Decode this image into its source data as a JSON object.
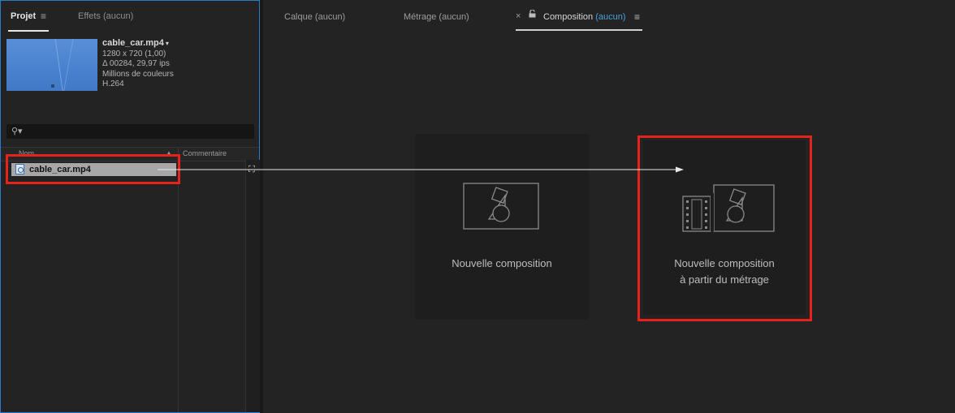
{
  "project_panel": {
    "tabs": [
      {
        "label": "Projet",
        "menu_glyph": "≡"
      },
      {
        "label": "Effets (aucun)"
      }
    ],
    "file_info": {
      "name": "cable_car.mp4",
      "caret": "▾",
      "lines": [
        "1280 x 720 (1,00)",
        "Δ 00284, 29,97 ips",
        "Millions de couleurs",
        "H.264"
      ]
    },
    "search": {
      "icon_glyph": "⚲▾",
      "value": "",
      "placeholder": ""
    },
    "columns": {
      "name": "Nom",
      "sort_glyph": "▲",
      "comment": "Commentaire"
    },
    "items": [
      {
        "label": "cable_car.mp4"
      }
    ],
    "flowchart_glyph": "⛶"
  },
  "viewer": {
    "tabs": [
      {
        "label": "Calque",
        "suffix": "(aucun)"
      },
      {
        "label": "Métrage",
        "suffix": "(aucun)"
      }
    ],
    "active_tab": {
      "close_glyph": "×",
      "lock_glyph": "🔓",
      "label": "Composition",
      "suffix": "(aucun)",
      "menu_glyph": "≡"
    },
    "cards": [
      {
        "line1": "Nouvelle composition",
        "line2": ""
      },
      {
        "line1": "Nouvelle composition",
        "line2": "à partir du métrage"
      }
    ]
  },
  "colors": {
    "accent_blue": "#4a9fe0",
    "annotation_red": "#e5231b",
    "panel_focus_border": "#2d78c8"
  }
}
